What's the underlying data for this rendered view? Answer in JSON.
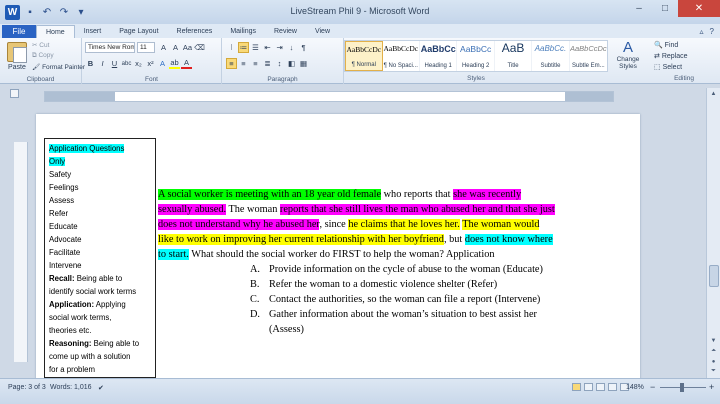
{
  "window": {
    "title": "LiveStream Phil 9 - Microsoft Word",
    "app_logo": "W",
    "minimize": "–",
    "maximize": "□",
    "close": "✕"
  },
  "qat_icons": [
    "save-icon",
    "undo-icon",
    "redo-icon",
    "customize-icon"
  ],
  "tabs": [
    "Home",
    "Insert",
    "Page Layout",
    "References",
    "Mailings",
    "Review",
    "View"
  ],
  "file_tab": "File",
  "tab_right": {
    "minimize_ribbon": "▵",
    "help": "?"
  },
  "ribbon": {
    "clipboard": {
      "paste": "Paste",
      "cut": "Cut",
      "copy": "Copy",
      "format_painter": "Format Painter",
      "label": "Clipboard"
    },
    "font": {
      "font_name": "Times New Rom",
      "font_size": "11",
      "label": "Font",
      "buttons": [
        "B",
        "I",
        "U",
        "abc",
        "x₂",
        "x²",
        "A",
        "ab",
        "A"
      ]
    },
    "paragraph": {
      "label": "Paragraph",
      "buttons": [
        "≡",
        "≡",
        "≡",
        "≣",
        "↕",
        "¶"
      ]
    },
    "styles": {
      "label": "Styles",
      "items": [
        {
          "sample": "AaBbCcDc",
          "name": "¶ Normal"
        },
        {
          "sample": "AaBbCcDc",
          "name": "¶ No Spaci..."
        },
        {
          "sample": "AaBbCc",
          "name": "Heading 1"
        },
        {
          "sample": "AaBbCc",
          "name": "Heading 2"
        },
        {
          "sample": "AaB",
          "name": "Title"
        },
        {
          "sample": "AaBbCc.",
          "name": "Subtitle"
        },
        {
          "sample": "AaBbCcDc",
          "name": "Subtle Em..."
        }
      ],
      "change_styles": "Change Styles"
    },
    "editing": {
      "label": "Editing",
      "find": "Find",
      "replace": "Replace",
      "select": "Select"
    }
  },
  "sidebar_box": {
    "lines": [
      {
        "text": "Application Questions",
        "highlight": "cyan"
      },
      {
        "text": "Only",
        "highlight": "cyan"
      },
      {
        "text": "Safety"
      },
      {
        "text": "Feelings"
      },
      {
        "text": "Assess"
      },
      {
        "text": "Refer"
      },
      {
        "text": "Educate"
      },
      {
        "text": "Advocate"
      },
      {
        "text": "Facilitate"
      },
      {
        "text": "Intervene"
      }
    ],
    "recall_label": "Recall:",
    "recall_text_1": " Being able to",
    "recall_text_2": "identify social work terms",
    "application_label": "Application:",
    "application_text_1": " Applying",
    "application_text_2": "social work terms,",
    "application_text_3": "theories etc.",
    "reasoning_label": "Reasoning:",
    "reasoning_text_1": " Being able to",
    "reasoning_text_2": "come up with a solution",
    "reasoning_text_3": "for a problem"
  },
  "question": {
    "l1_a": "A social worker is meeting with an 18 year old female",
    "l1_b": " who reports that ",
    "l1_c": "she was recently",
    "l2_a": "sexually abused.",
    "l2_b": " The woman ",
    "l2_c": "reports that she still lives the man who abused her and that she just",
    "l3_a": "does not understand why he abused her",
    "l3_b": ", since ",
    "l3_c": "he claims that he loves her.",
    "l3_d": " ",
    "l3_e": "The woman would",
    "l4_a": "like to work on improving her current relationship with her boyfriend",
    "l4_b": ", but ",
    "l4_c": "does not know where",
    "l5_a": "to start.",
    "l5_b": " What should the social worker do FIRST to help the woman? Application",
    "options": [
      {
        "letter": "A.",
        "text": "Provide information on the cycle of abuse to the woman (Educate)"
      },
      {
        "letter": "B.",
        "text": "Refer the woman to a domestic violence shelter (Refer)"
      },
      {
        "letter": "C.",
        "text": "Contact the authorities, so the woman can file a report (Intervene)"
      },
      {
        "letter": "D.",
        "text": "Gather information about the woman’s situation to best assist her"
      }
    ],
    "option_d_cont": "(Assess)"
  },
  "status": {
    "page": "Page: 3 of 3",
    "words": "Words: 1,016",
    "zoom": "148%",
    "zoom_out": "−",
    "zoom_in": "+"
  }
}
